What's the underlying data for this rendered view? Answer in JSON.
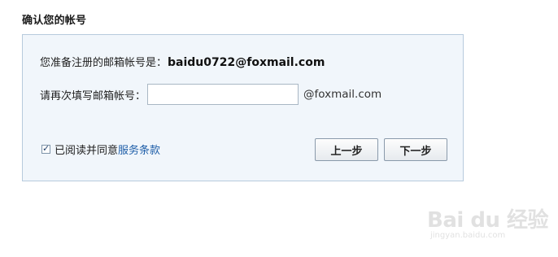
{
  "page": {
    "title": "确认您的帐号"
  },
  "email_row": {
    "label": "您准备注册的邮箱帐号是：",
    "value": "baidu0722@foxmail.com"
  },
  "confirm_row": {
    "label": "请再次填写邮箱帐号：",
    "input_value": "",
    "input_placeholder": "",
    "suffix": "@foxmail.com"
  },
  "agreement": {
    "checked": true,
    "label": "已阅读并同意",
    "link": "服务条款"
  },
  "buttons": {
    "prev": "上一步",
    "next": "下一步"
  },
  "watermark": {
    "logo": "Bai du 经验",
    "url": "jingyan.baidu.com"
  }
}
